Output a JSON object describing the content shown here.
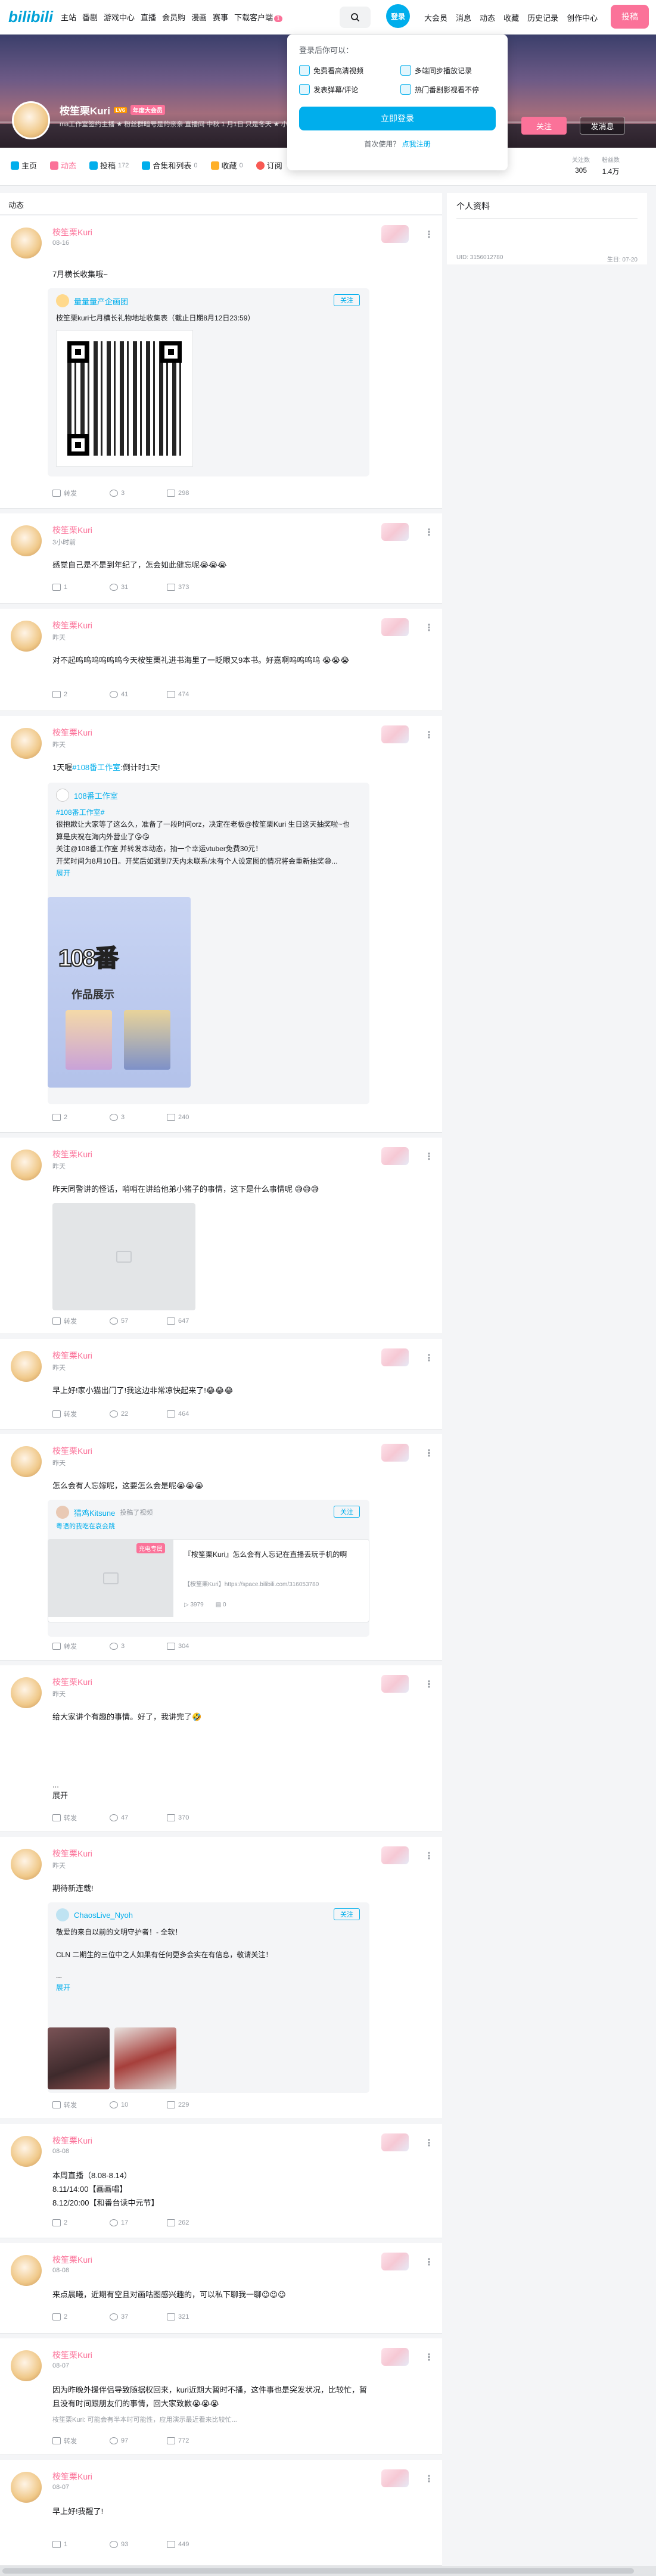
{
  "nav": {
    "logo": "bilibili",
    "left_items": [
      "主站",
      "番剧",
      "游戏中心",
      "直播",
      "会员购",
      "漫画",
      "赛事"
    ],
    "download": "下载客户端",
    "download_badge": "1",
    "login": "登录",
    "right_items": [
      "大会员",
      "消息",
      "动态",
      "收藏",
      "历史记录",
      "创作中心"
    ],
    "upload": "投稿"
  },
  "popup": {
    "title": "登录后你可以：",
    "benefits": [
      "免费看高清视频",
      "多端同步播放记录",
      "发表弹幕/评论",
      "热门番剧影视看不停"
    ],
    "login_button": "立即登录",
    "register_prompt": "首次使用？",
    "register_link": "点我注册"
  },
  "profile": {
    "name": "桉笙栗Kuri",
    "level": "LV6",
    "vip": "年度大会员",
    "sign": "ma工作室签约主播 ★ 粉丝群暗号是的亲亲 直播间 中秋 1 月1日 只是冬天 ★ 小星星",
    "follow": "关注",
    "message": "发消息"
  },
  "tabs": [
    {
      "label": "主页",
      "count": ""
    },
    {
      "label": "动态",
      "count": ""
    },
    {
      "label": "投稿",
      "count": "172"
    },
    {
      "label": "合集和列表",
      "count": "0"
    },
    {
      "label": "收藏",
      "count": "0"
    },
    {
      "label": "订阅",
      "count": ""
    }
  ],
  "stats": [
    {
      "label": "关注数",
      "value": "305"
    },
    {
      "label": "粉丝数",
      "value": "1.4万"
    }
  ],
  "section_header": "动态",
  "side_profile": {
    "title": "个人资料",
    "uid": "UID: 3156012780",
    "birthday": "生日: 07-20"
  },
  "feed": [
    {
      "name": "桉笙栗Kuri",
      "time": "08-16",
      "text": "7月横长收集哦~",
      "shared_name": "量量量产企画团",
      "shared_follow": "关注",
      "shared_text": "桉笙栗kuri七月横长礼物地址收集表（截止日期8月12日23:59）",
      "forward": "转发",
      "comment": "3",
      "like": "298"
    },
    {
      "name": "桉笙栗Kuri",
      "time": "3小时前",
      "text": "感觉自己是不是到年纪了，怎会如此健忘呢😭😭😭",
      "forward": "1",
      "comment": "31",
      "like": "373"
    },
    {
      "name": "桉笙栗Kuri",
      "time": "昨天",
      "text": "对不起呜呜呜呜呜呜今天桉笙栗礼进书海里了一眨眼又9本书。好嘉啊呜呜呜呜 😭😭😭",
      "forward": "2",
      "comment": "41",
      "like": "474"
    },
    {
      "name": "桉笙栗Kuri",
      "time": "昨天",
      "text_pre": "1天喔",
      "text_link": "#108番工作室",
      "text_post": ":倒计时1天!",
      "shared_name": "108番工作室",
      "tag": "#108番工作室#",
      "shared_text_1": "很抱歉让大家等了这么久，准备了一段时间orz，决定在老板@桉笙栗Kuri 生日这天抽奖啦~也算是庆祝在海内外营业了😘😘",
      "shared_text_2": "关注@108番工作室 并转发本动态，抽一个幸运vtuber免费30元！",
      "shared_text_3": "开奖时间为8月10日。开奖后如遇到7天内未联系/未有个人设定图的情况将会重新抽奖😅...",
      "expand": "展开",
      "poster_title": "108番",
      "poster_sub": "作品展示",
      "forward": "2",
      "comment": "3",
      "like": "240"
    },
    {
      "name": "桉笙栗Kuri",
      "time": "昨天",
      "text": "昨天同警讲的怪话，哨哨在讲给他弟小猪子的事情，这下是什么事情呢 😅😅😅",
      "forward": "转发",
      "comment": "57",
      "like": "647"
    },
    {
      "name": "桉笙栗Kuri",
      "time": "昨天",
      "text": "早上好!家小猫出门了!我这边非常凉快起来了!😂😂😂",
      "forward": "转发",
      "comment": "22",
      "like": "464"
    },
    {
      "name": "桉笙栗Kuri",
      "time": "昨天",
      "text": "怎么会有人忘嫁呢，这要怎么会是呢😭😭😭",
      "shared_name": "猎鸡Kitsune",
      "shared_meta": "投稿了视频",
      "shared_follow": "关注",
      "shared_note": "粤语的我吃在哀会跳",
      "video_tag": "充电专属",
      "video_title": "『桉笙栗Kuri』怎么会有人忘记在直播丢玩手机的啊",
      "video_sub": "【桉笙栗Kuri】https://space.bilibili.com/316053780",
      "video_views": "3979",
      "video_dm": "0",
      "forward": "转发",
      "comment": "3",
      "like": "304"
    },
    {
      "name": "桉笙栗Kuri",
      "time": "昨天",
      "text": "给大家讲个有趣的事情。好了，我讲完了🤣",
      "ellipsis": "...",
      "expand": "展开",
      "forward": "转发",
      "comment": "47",
      "like": "370"
    },
    {
      "name": "桉笙栗Kuri",
      "time": "昨天",
      "text": "期待新连载!",
      "shared_name": "ChaosLive_Nyoh",
      "shared_follow": "关注",
      "shared_text_1": "敬爱的来自以前的文明守护者！- 全软！",
      "shared_text_2": "CLN 二期生的三位中之人如果有任何更多会实在有信息，敬请关注！",
      "ellipsis": "...",
      "expand": "展开",
      "forward": "转发",
      "comment": "10",
      "like": "229"
    },
    {
      "name": "桉笙栗Kuri",
      "time": "08-08",
      "text_lines": [
        "本周直播（8.08-8.14）",
        "8.11/14:00【画画唱】",
        "8.12/20:00【和番台读中元节】"
      ],
      "forward": "2",
      "comment": "17",
      "like": "262"
    },
    {
      "name": "桉笙栗Kuri",
      "time": "08-08",
      "text": "来点晨曦，近期有空且对画咕图感兴趣的，可以私下聊我一聊😉😉😉",
      "forward": "2",
      "comment": "37",
      "like": "321"
    },
    {
      "name": "桉笙栗Kuri",
      "time": "08-07",
      "text": "因为昨晚外援伴侣导致随据权回来，kuri近期大暂时不播，这件事也是突发状况，比较忙，暂且没有时间跟朋友们的事情，回大家致歉😭😭😭",
      "quote": "桉笙栗Kuri: 可能会有半本时可能性，应用演示最近看来比较忙...",
      "forward": "转发",
      "comment": "97",
      "like": "772"
    },
    {
      "name": "桉笙栗Kuri",
      "time": "08-07",
      "text": "早上好!我醒了!",
      "forward": "1",
      "comment": "93",
      "like": "449"
    }
  ]
}
